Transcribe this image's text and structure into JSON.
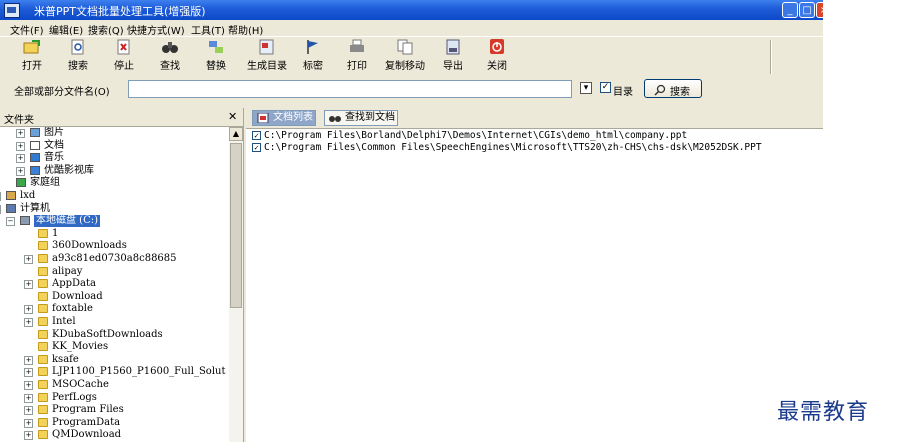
{
  "window": {
    "title": "米普PPT文档批量处理工具(增强版)"
  },
  "menu": [
    "文件(F)",
    "编辑(E)",
    "搜索(Q)",
    "快捷方式(W)",
    "工具(T)",
    "帮助(H)"
  ],
  "toolbar": {
    "open": "打开",
    "search": "搜索",
    "stop": "停止",
    "find": "查找",
    "replace": "替换",
    "gen_toc": "生成目录",
    "mark": "标密",
    "print": "打印",
    "copy_move": "复制移动",
    "export": "导出",
    "close": "关闭"
  },
  "search_bar": {
    "label": "全部或部分文件名(O)",
    "value": "",
    "toc_checkbox": "目录",
    "search_button": "搜索"
  },
  "left_pane": {
    "title": "文件夹",
    "tree": [
      {
        "label": "图片"
      },
      {
        "label": "文档"
      },
      {
        "label": "音乐"
      },
      {
        "label": "优酷影视库"
      },
      {
        "label": "家庭组"
      },
      {
        "label": "lxd"
      },
      {
        "label": "计算机"
      },
      {
        "label": "本地磁盘 (C:)"
      },
      {
        "label": "1"
      },
      {
        "label": "360Downloads"
      },
      {
        "label": "a93c81ed0730a8c88685"
      },
      {
        "label": "alipay"
      },
      {
        "label": "AppData"
      },
      {
        "label": "Download"
      },
      {
        "label": "foxtable"
      },
      {
        "label": "Intel"
      },
      {
        "label": "KDubaSoftDownloads"
      },
      {
        "label": "KK_Movies"
      },
      {
        "label": "ksafe"
      },
      {
        "label": "LJP1100_P1560_P1600_Full_Solut"
      },
      {
        "label": "MSOCache"
      },
      {
        "label": "PerfLogs"
      },
      {
        "label": "Program Files"
      },
      {
        "label": "ProgramData"
      },
      {
        "label": "QMDownload"
      }
    ]
  },
  "right_pane": {
    "tabs": [
      "文档列表",
      "查找到文档"
    ],
    "files": [
      "C:\\Program Files\\Borland\\Delphi7\\Demos\\Internet\\CGIs\\demo_html\\company.ppt",
      "C:\\Program Files\\Common Files\\SpeechEngines\\Microsoft\\TTS20\\zh-CHS\\chs-dsk\\M2052DSK.PPT"
    ]
  },
  "watermark": "最需教育",
  "colors": {
    "titlebar": "#0b49c8",
    "selection": "#316ac5",
    "folder": "#f3d25a",
    "chrome": "#ece9d8"
  }
}
